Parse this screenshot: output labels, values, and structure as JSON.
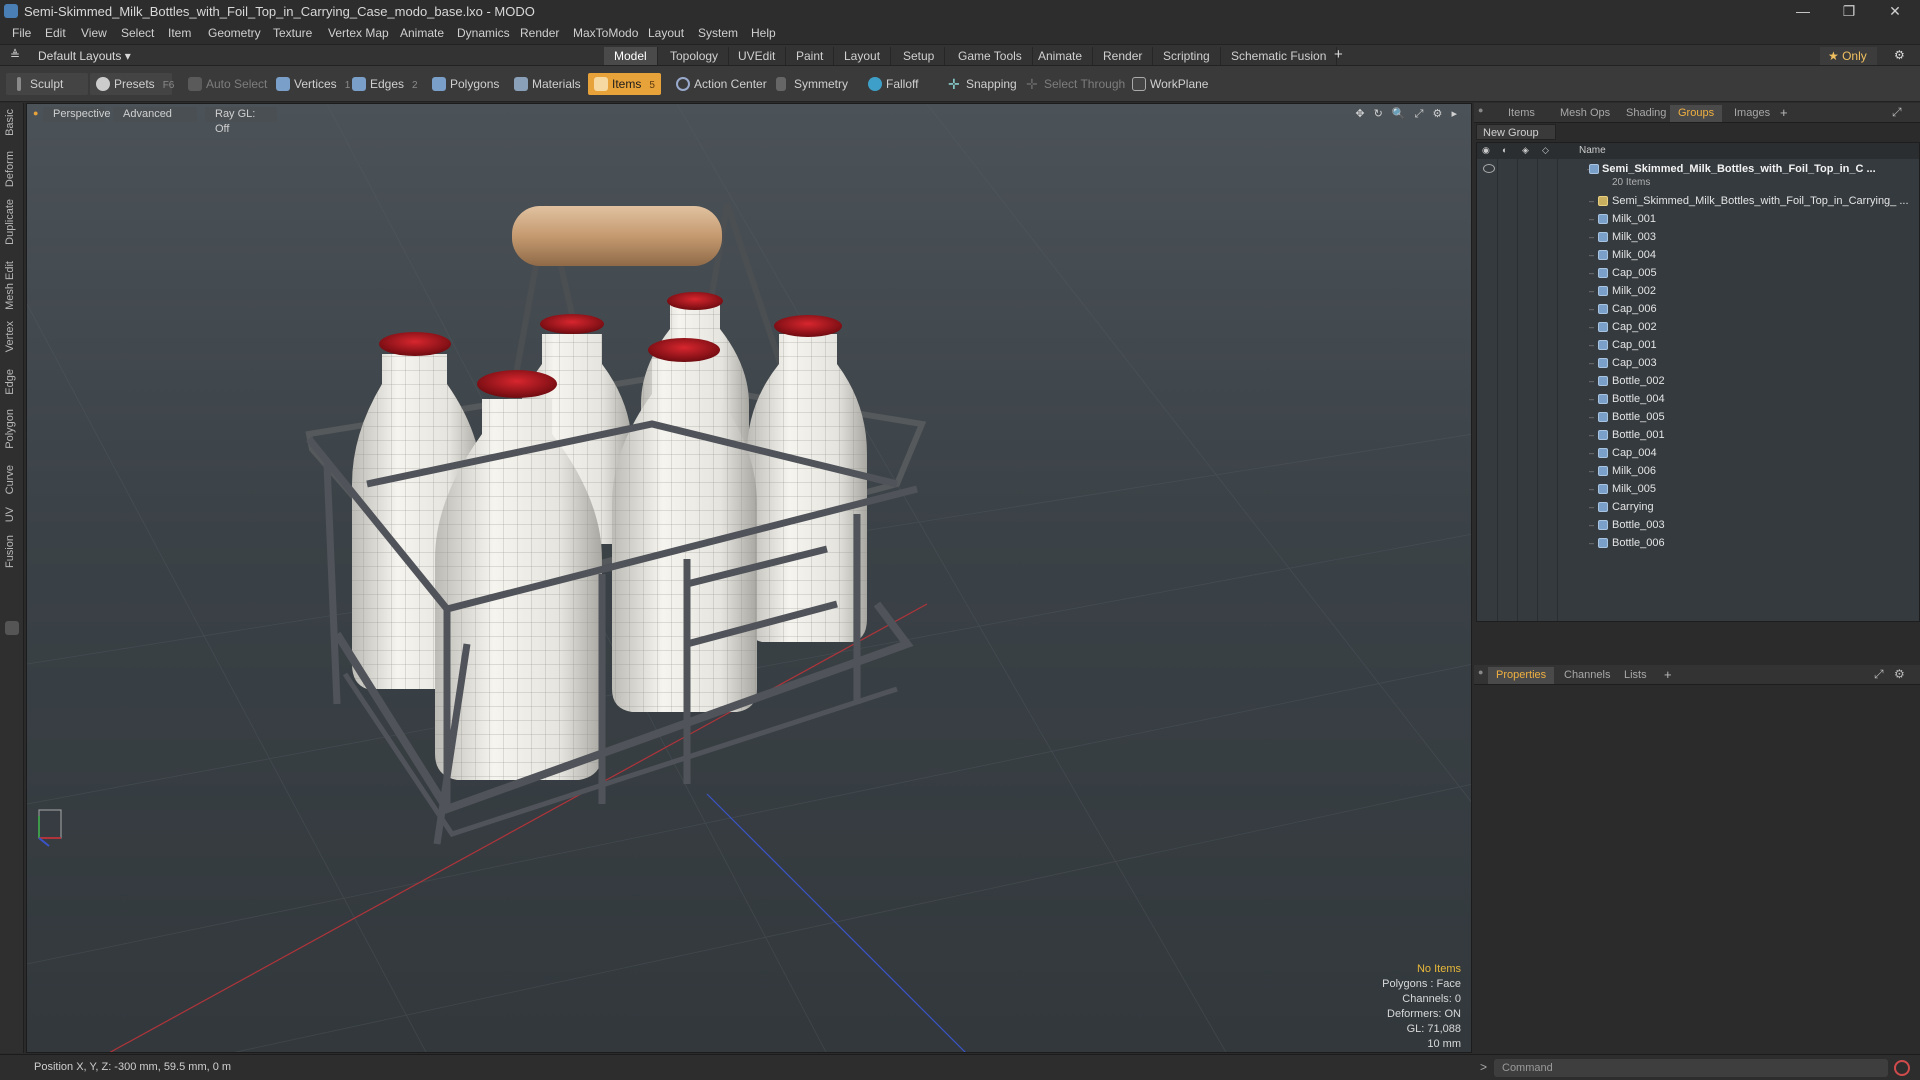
{
  "app": {
    "title": "Semi-Skimmed_Milk_Bottles_with_Foil_Top_in_Carrying_Case_modo_base.lxo - MODO",
    "window_controls": [
      "—",
      "❐",
      "✕"
    ]
  },
  "menu": [
    "File",
    "Edit",
    "View",
    "Select",
    "Item",
    "Geometry",
    "Texture",
    "Vertex Map",
    "Animate",
    "Dynamics",
    "Render",
    "MaxToModo",
    "Layout",
    "System",
    "Help"
  ],
  "layout_bar": {
    "layout_select": "Default Layouts ▾",
    "tabs": [
      "Model",
      "Topology",
      "UVEdit",
      "Paint",
      "Layout",
      "Setup",
      "Game Tools",
      "Animate",
      "Render",
      "Scripting",
      "Schematic Fusion"
    ],
    "active_tab": "Model",
    "add": "+",
    "only": "★  Only",
    "settings": "⚙"
  },
  "toolbar": {
    "sculpt": "Sculpt",
    "presets": "Presets",
    "presets_key": "F6",
    "auto_select": "Auto Select",
    "vertices": "Vertices",
    "vertices_count": "1",
    "edges": "Edges",
    "edges_count": "2",
    "polygons": "Polygons",
    "materials": "Materials",
    "items": "Items",
    "items_count": "5",
    "action_center": "Action Center",
    "symmetry": "Symmetry",
    "falloff": "Falloff",
    "snapping": "Snapping",
    "select_through": "Select Through",
    "workplane": "WorkPlane"
  },
  "left_tabs": [
    "Basic",
    "Deform",
    "Duplicate",
    "Mesh Edit",
    "Vertex",
    "Edge",
    "Polygon",
    "Curve",
    "UV",
    "Fusion"
  ],
  "viewport": {
    "view": "Perspective",
    "shading": "Advanced",
    "raygl": "Ray GL: Off",
    "tools": [
      "✥",
      "↻",
      "🔍",
      "⤢",
      "⚙",
      "▸"
    ],
    "info": {
      "no_items": "No Items",
      "polygons": "Polygons : Face",
      "channels": "Channels: 0",
      "deformers": "Deformers: ON",
      "gl": "GL: 71,088",
      "scale": "10 mm"
    }
  },
  "status": {
    "position": "Position X, Y, Z:  -300 mm, 59.5 mm, 0 m"
  },
  "items_panel": {
    "tabs": [
      "Items",
      "Mesh Ops",
      "Shading",
      "Groups",
      "Images"
    ],
    "active_tab": "Groups",
    "new_group": "New Group",
    "column_name": "Name",
    "root": {
      "label": "Semi_Skimmed_Milk_Bottles_with_Foil_Top_in_C ...",
      "count": "20 Items"
    },
    "rows": [
      "Semi_Skimmed_Milk_Bottles_with_Foil_Top_in_Carrying_ ...",
      "Milk_001",
      "Milk_003",
      "Milk_004",
      "Cap_005",
      "Milk_002",
      "Cap_006",
      "Cap_002",
      "Cap_001",
      "Cap_003",
      "Bottle_002",
      "Bottle_004",
      "Bottle_005",
      "Bottle_001",
      "Cap_004",
      "Milk_006",
      "Milk_005",
      "Carrying",
      "Bottle_003",
      "Bottle_006"
    ]
  },
  "properties_panel": {
    "tabs": [
      "Properties",
      "Channels",
      "Lists"
    ],
    "active_tab": "Properties",
    "add": "+"
  },
  "command": {
    "placeholder": "Command",
    "prompt": ">"
  },
  "colors": {
    "accent": "#e8a23a",
    "cap_red": "#b0141b",
    "bottle": "#eceae4",
    "crate_metal": "#55595c",
    "handle_wood": "#c8a27a"
  }
}
